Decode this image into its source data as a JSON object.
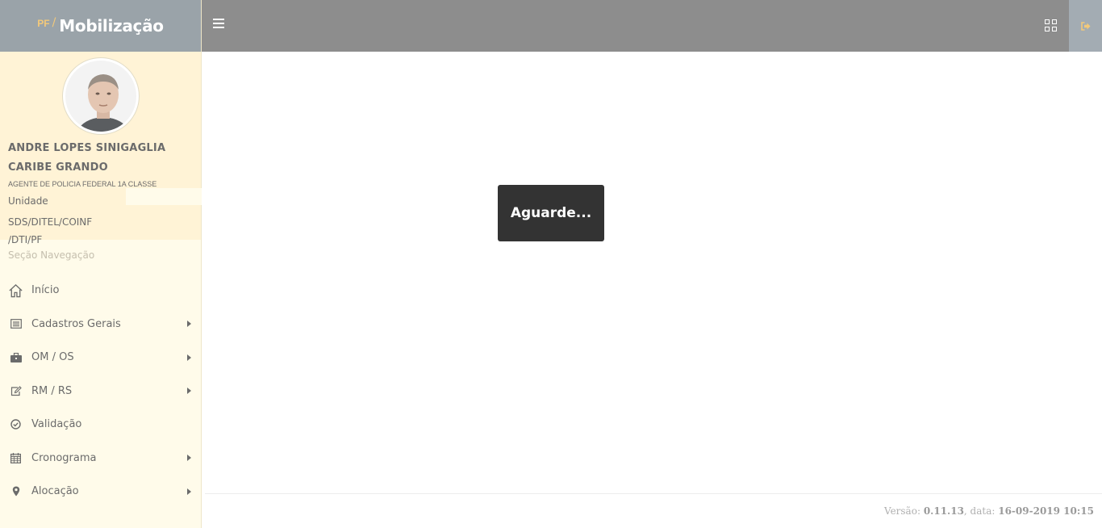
{
  "brand": {
    "prefix": "PF",
    "separator": "/",
    "title": "Mobilização"
  },
  "user": {
    "name": "ANDRE LOPES SINIGAGLIA CARIBE GRANDO",
    "role": "AGENTE DE POLICIA FEDERAL 1A CLASSE",
    "unit_label": "Unidade",
    "unit_value": "SDS/DITEL/COINF /DTI/PF"
  },
  "nav": {
    "section_title": "Seção Navegação",
    "items": [
      {
        "label": "Início",
        "icon": "home-icon",
        "has_submenu": false
      },
      {
        "label": "Cadastros Gerais",
        "icon": "list-icon",
        "has_submenu": true
      },
      {
        "label": "OM / OS",
        "icon": "briefcase-icon",
        "has_submenu": true
      },
      {
        "label": "RM / RS",
        "icon": "edit-icon",
        "has_submenu": true
      },
      {
        "label": "Validação",
        "icon": "check-circle-icon",
        "has_submenu": false
      },
      {
        "label": "Cronograma",
        "icon": "calendar-icon",
        "has_submenu": true
      },
      {
        "label": "Alocação",
        "icon": "map-marker-icon",
        "has_submenu": true
      }
    ]
  },
  "loading": {
    "text": "Aguarde..."
  },
  "footer": {
    "version_label": "Versão:",
    "version_value": "0.11.13",
    "date_label": ", data:",
    "date_value": "16-09-2019 10:15"
  },
  "colors": {
    "topbar": "#8d8d8d",
    "brand_bg": "#9aa3a9",
    "sidebar_bg": "#fffbea",
    "profile_bg": "#fff3d6",
    "loading_bg": "#333333",
    "accent": "#f3c97a"
  }
}
